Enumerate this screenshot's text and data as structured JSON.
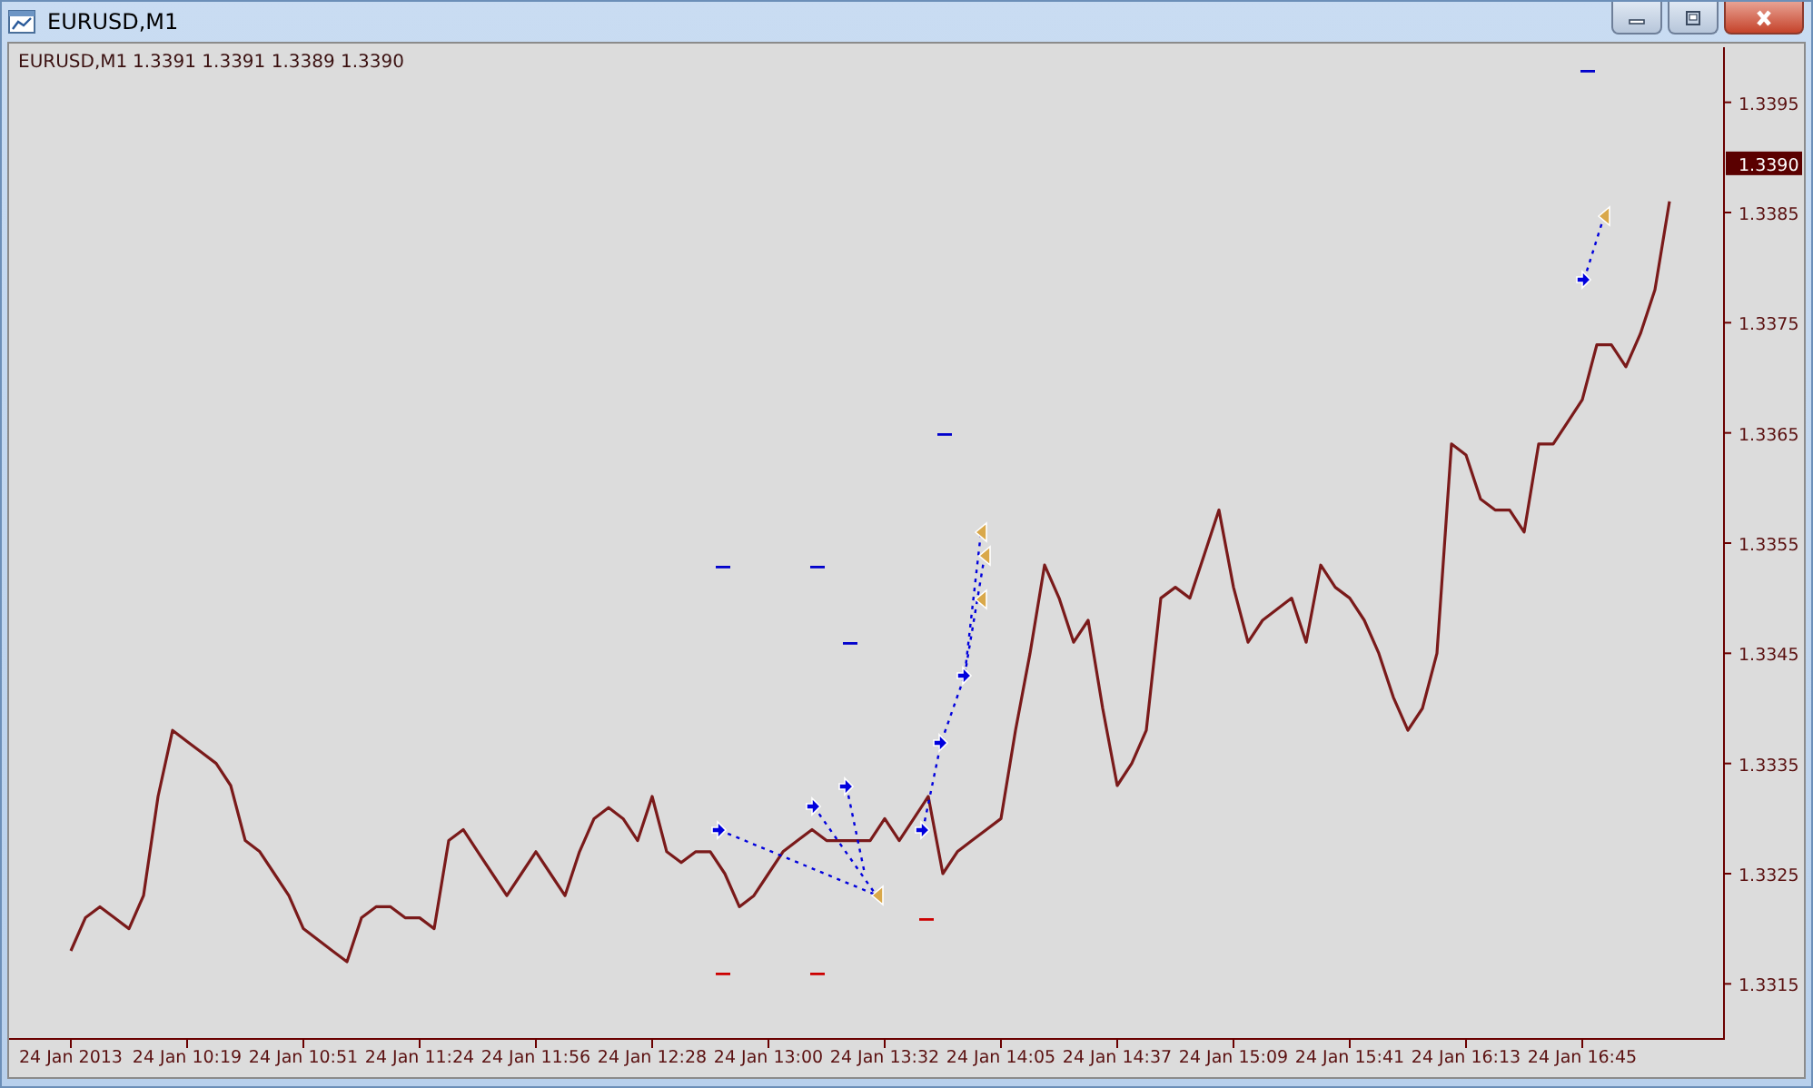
{
  "window": {
    "title": "EURUSD,M1",
    "buttons": [
      {
        "kind": "minimize"
      },
      {
        "kind": "maximize"
      },
      {
        "kind": "close"
      }
    ]
  },
  "chart": {
    "chart_data": {
      "type": "line",
      "title": "1.3391 1.3391 1.3389 1.3390",
      "categories": [
        "24 Jan 2013",
        null,
        null,
        null,
        null,
        null,
        null,
        null,
        "24 Jan 10:19",
        null,
        null,
        null,
        null,
        null,
        null,
        null,
        "24 Jan 10:51",
        null,
        null,
        null,
        null,
        null,
        null,
        null,
        "24 Jan 11:24",
        null,
        null,
        null,
        null,
        null,
        null,
        null,
        "24 Jan 11:56",
        null,
        null,
        null,
        null,
        null,
        null,
        null,
        "24 Jan 12:28",
        null,
        null,
        null,
        null,
        null,
        null,
        null,
        "24 Jan 13:00",
        null,
        null,
        null,
        null,
        null,
        null,
        null,
        "24 Jan 13:32",
        null,
        null,
        null,
        null,
        null,
        null,
        null,
        "24 Jan 14:05",
        null,
        null,
        null,
        null,
        null,
        null,
        null,
        "24 Jan 14:37",
        null,
        null,
        null,
        null,
        null,
        null,
        null,
        "24 Jan 15:09",
        null,
        null,
        null,
        null,
        null,
        null,
        null,
        "24 Jan 15:41",
        null,
        null,
        null,
        null,
        null,
        null,
        null,
        "24 Jan 16:13",
        null,
        null,
        null,
        null,
        null,
        null,
        null,
        "24 Jan 16:45",
        null,
        null,
        null,
        null,
        null,
        null
      ],
      "ylim": [
        1.331,
        1.34
      ],
      "yticks": [
        {
          "value": 1.3395,
          "label": "1.3395"
        },
        {
          "value": 1.3385,
          "label": "1.3385"
        },
        {
          "value": 1.3375,
          "label": "1.3375"
        },
        {
          "value": 1.3365,
          "label": "1.3365"
        },
        {
          "value": 1.3355,
          "label": "1.3355"
        },
        {
          "value": 1.3345,
          "label": "1.3345"
        },
        {
          "value": 1.3335,
          "label": "1.3335"
        },
        {
          "value": 1.3325,
          "label": "1.3325"
        },
        {
          "value": 1.3315,
          "label": "1.3315"
        }
      ],
      "series": [
        {
          "name": "EURUSD,M1",
          "color": "#7a1a1a",
          "values": [
            1.3318,
            1.3321,
            1.3322,
            1.3321,
            1.332,
            1.3323,
            1.3332,
            1.3338,
            1.3337,
            1.3336,
            1.3335,
            1.3333,
            1.3328,
            1.3327,
            1.3325,
            1.3323,
            1.332,
            1.3319,
            1.3318,
            1.3317,
            1.3321,
            1.3322,
            1.3322,
            1.3321,
            1.3321,
            1.332,
            1.3328,
            1.3329,
            1.3327,
            1.3325,
            1.3323,
            1.3325,
            1.3327,
            1.3325,
            1.3323,
            1.3327,
            1.333,
            1.3331,
            1.333,
            1.3328,
            1.3332,
            1.3327,
            1.3326,
            1.3327,
            1.3327,
            1.3325,
            1.3322,
            1.3323,
            1.3325,
            1.3327,
            1.3328,
            1.3329,
            1.3328,
            1.3328,
            1.3328,
            1.3328,
            1.333,
            1.3328,
            1.333,
            1.3332,
            1.3325,
            1.3327,
            1.3328,
            1.3329,
            1.333,
            1.3338,
            1.3345,
            1.3353,
            1.335,
            1.3346,
            1.3348,
            1.334,
            1.3333,
            1.3335,
            1.3338,
            1.335,
            1.3351,
            1.335,
            1.3354,
            1.3358,
            1.3351,
            1.3346,
            1.3348,
            1.3349,
            1.335,
            1.3346,
            1.3353,
            1.3351,
            1.335,
            1.3348,
            1.3345,
            1.3341,
            1.3338,
            1.334,
            1.3345,
            1.3364,
            1.3363,
            1.3359,
            1.3358,
            1.3358,
            1.3356,
            1.3364,
            1.3364,
            1.3366,
            1.3368,
            1.3373,
            1.3373,
            1.3371,
            1.3374,
            1.3378,
            1.3386
          ]
        }
      ]
    },
    "current_price": "1.3390"
  }
}
